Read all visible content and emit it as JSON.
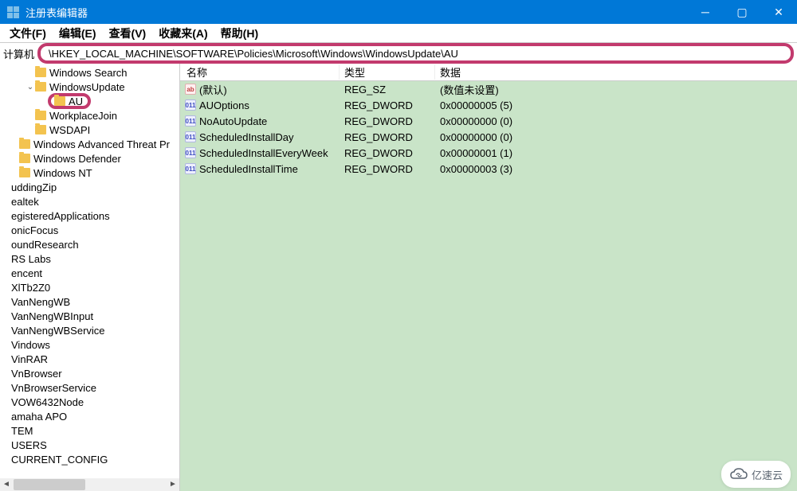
{
  "window": {
    "title": "注册表编辑器"
  },
  "menu": {
    "file": "文件(F)",
    "edit": "编辑(E)",
    "view": "查看(V)",
    "favorites": "收藏来(A)",
    "help": "帮助(H)"
  },
  "address": {
    "label": "计算机",
    "path": "\\HKEY_LOCAL_MACHINE\\SOFTWARE\\Policies\\Microsoft\\Windows\\WindowsUpdate\\AU"
  },
  "tree": {
    "items": [
      {
        "level": 2,
        "label": "Windows Search",
        "icon": true
      },
      {
        "level": 2,
        "label": "WindowsUpdate",
        "icon": true,
        "expanded": true
      },
      {
        "level": 3,
        "label": "AU",
        "icon": true,
        "highlight": true
      },
      {
        "level": 2,
        "label": "WorkplaceJoin",
        "icon": true
      },
      {
        "level": 2,
        "label": "WSDAPI",
        "icon": true
      },
      {
        "level": 1,
        "label": "Windows Advanced Threat Pr",
        "icon": true
      },
      {
        "level": 1,
        "label": "Windows Defender",
        "icon": true
      },
      {
        "level": 1,
        "label": "Windows NT",
        "icon": true
      },
      {
        "level": 0,
        "label": "uddingZip"
      },
      {
        "level": 0,
        "label": "ealtek"
      },
      {
        "level": 0,
        "label": "egisteredApplications"
      },
      {
        "level": 0,
        "label": "onicFocus"
      },
      {
        "level": 0,
        "label": "oundResearch"
      },
      {
        "level": 0,
        "label": "RS Labs"
      },
      {
        "level": 0,
        "label": "encent"
      },
      {
        "level": 0,
        "label": "XlTb2Z0"
      },
      {
        "level": 0,
        "label": "VanNengWB"
      },
      {
        "level": 0,
        "label": "VanNengWBInput"
      },
      {
        "level": 0,
        "label": "VanNengWBService"
      },
      {
        "level": 0,
        "label": "Vindows"
      },
      {
        "level": 0,
        "label": "VinRAR"
      },
      {
        "level": 0,
        "label": "VnBrowser"
      },
      {
        "level": 0,
        "label": "VnBrowserService"
      },
      {
        "level": 0,
        "label": "VOW6432Node"
      },
      {
        "level": 0,
        "label": "amaha APO"
      },
      {
        "level": 0,
        "label": "TEM"
      },
      {
        "level": 0,
        "label": "USERS"
      },
      {
        "level": 0,
        "label": "CURRENT_CONFIG"
      }
    ]
  },
  "values": {
    "headers": {
      "name": "名称",
      "type": "类型",
      "data": "数据"
    },
    "rows": [
      {
        "icon": "string",
        "name": "(默认)",
        "type": "REG_SZ",
        "data": "(数值未设置)"
      },
      {
        "icon": "dword",
        "name": "AUOptions",
        "type": "REG_DWORD",
        "data": "0x00000005 (5)"
      },
      {
        "icon": "dword",
        "name": "NoAutoUpdate",
        "type": "REG_DWORD",
        "data": "0x00000000 (0)"
      },
      {
        "icon": "dword",
        "name": "ScheduledInstallDay",
        "type": "REG_DWORD",
        "data": "0x00000000 (0)"
      },
      {
        "icon": "dword",
        "name": "ScheduledInstallEveryWeek",
        "type": "REG_DWORD",
        "data": "0x00000001 (1)"
      },
      {
        "icon": "dword",
        "name": "ScheduledInstallTime",
        "type": "REG_DWORD",
        "data": "0x00000003 (3)"
      }
    ]
  },
  "watermark": {
    "text": "亿速云"
  }
}
